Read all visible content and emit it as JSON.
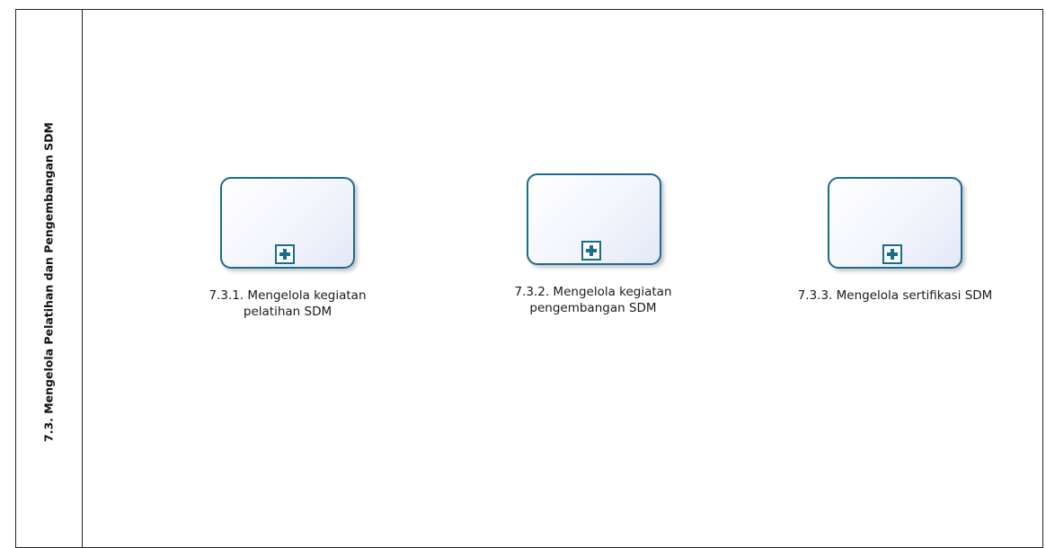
{
  "lane": {
    "title": "7.3. Mengelola Pelatihan dan Pengembangan SDM"
  },
  "tasks": [
    {
      "label_line1": "7.3.1. Mengelola kegiatan",
      "label_line2": "pelatihan SDM",
      "marker_icon": "collapsed-subprocess-plus-icon"
    },
    {
      "label_line1": "7.3.2. Mengelola kegiatan",
      "label_line2": "pengembangan SDM",
      "marker_icon": "collapsed-subprocess-plus-icon"
    },
    {
      "label_line1": "7.3.3. Mengelola sertifikasi SDM",
      "label_line2": "",
      "marker_icon": "collapsed-subprocess-plus-icon"
    }
  ],
  "colors": {
    "task_border": "#1b6b8e",
    "lane_border": "#222222"
  }
}
